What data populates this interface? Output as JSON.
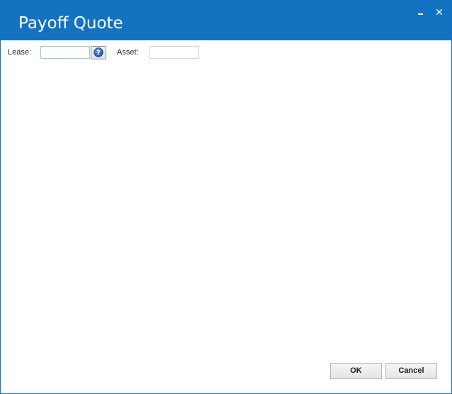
{
  "window": {
    "title": "Payoff Quote",
    "minimize_label": "_",
    "close_label": "✕"
  },
  "form": {
    "lease_label": "Lease:",
    "lease_value": "",
    "asset_label": "Asset:",
    "asset_value": ""
  },
  "icons": {
    "lookup": "help-lookup-icon",
    "minimize": "minimize-icon",
    "close": "close-icon"
  },
  "buttons": {
    "ok_label": "OK",
    "cancel_label": "Cancel"
  },
  "colors": {
    "titlebar": "#1373c1",
    "accent": "#1572c2"
  }
}
